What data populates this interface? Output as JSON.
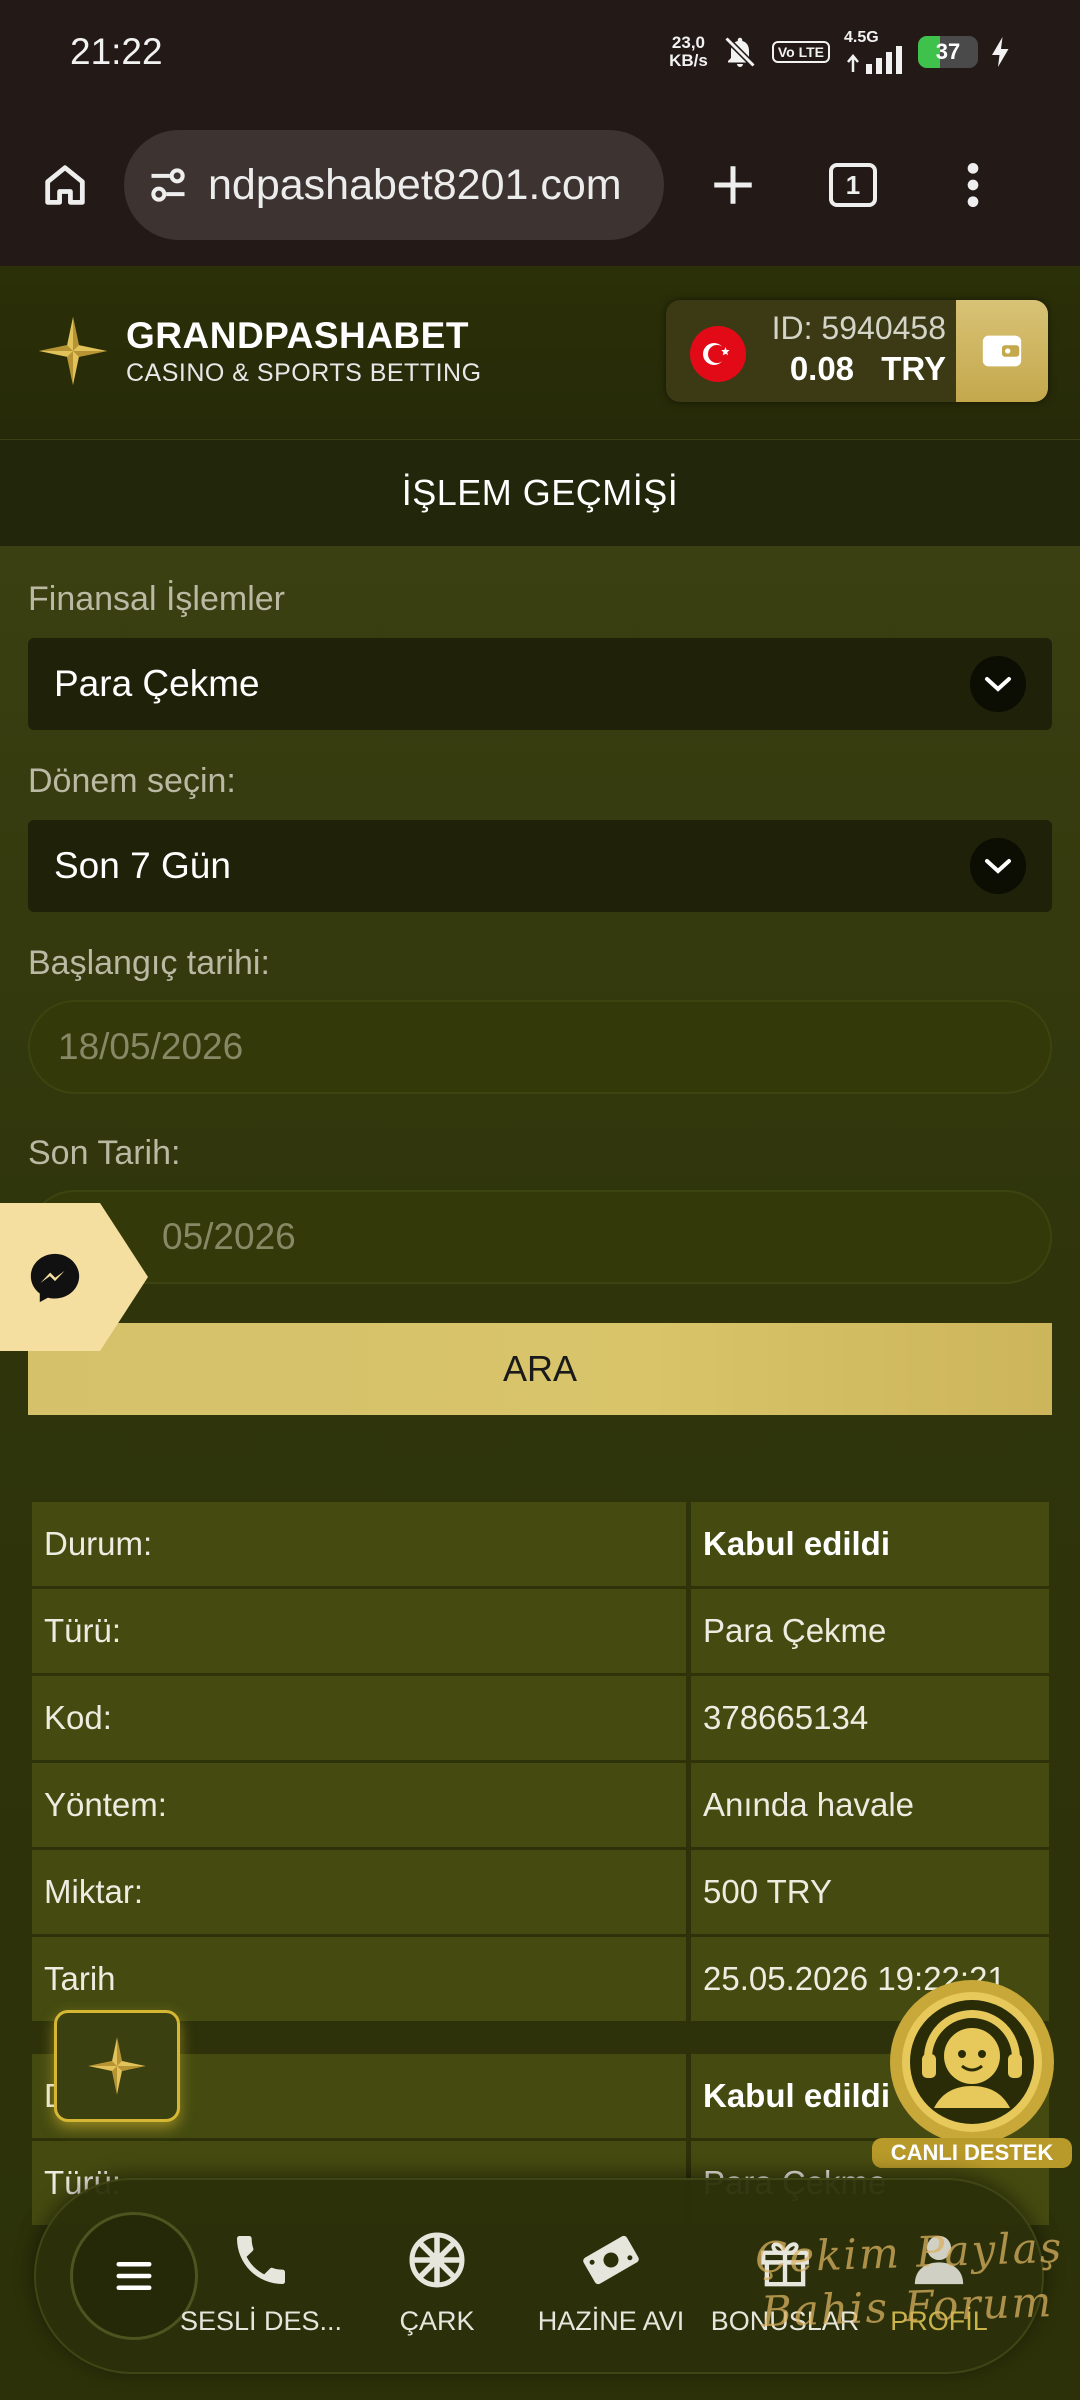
{
  "status_bar": {
    "time": "21:22",
    "net_speed": "23,0",
    "net_unit": "KB/s",
    "volte": "Vo LTE",
    "network": "4.5G",
    "battery": "37",
    "battery_level": 0.37
  },
  "browser": {
    "url": "ndpashabet8201.com",
    "tab_count": "1"
  },
  "site": {
    "brand": "GRANDPASHABET",
    "tagline": "CASINO & SPORTS BETTING",
    "account_id": "ID: 5940458",
    "balance": "0.08",
    "currency": "TRY"
  },
  "page": {
    "title": "İŞLEM GEÇMİŞİ",
    "filters": {
      "type_label": "Finansal İşlemler",
      "type_value": "Para Çekme",
      "period_label": "Dönem seçin:",
      "period_value": "Son 7 Gün",
      "start_label": "Başlangıç tarihi:",
      "start_value": "18/05/2026",
      "end_label": "Son Tarih:",
      "end_value": "05/2026",
      "search_label": "ARA"
    },
    "results": [
      {
        "rows": [
          {
            "key": "Durum:",
            "value": "Kabul edildi",
            "bold": true
          },
          {
            "key": "Türü:",
            "value": "Para Çekme"
          },
          {
            "key": "Kod:",
            "value": "378665134"
          },
          {
            "key": "Yöntem:",
            "value": "Anında havale"
          },
          {
            "key": "Miktar:",
            "value": "500 TRY"
          },
          {
            "key": "Tarih",
            "value": "25.05.2026 19:22:21"
          }
        ]
      },
      {
        "rows": [
          {
            "key": "D",
            "value": "Kabul edildi",
            "bold": true
          },
          {
            "key": "Türü:",
            "value": "Para Çekme"
          }
        ]
      }
    ]
  },
  "support": {
    "label": "CANLI DESTEK"
  },
  "bottom_nav": {
    "items": [
      {
        "label": "SESLİ DES...",
        "icon": "phone-icon"
      },
      {
        "label": "ÇARK",
        "icon": "wheel-icon"
      },
      {
        "label": "HAZİNE AVI",
        "icon": "treasure-icon"
      },
      {
        "label": "BONUSLAR",
        "icon": "gift-icon"
      },
      {
        "label": "PROFİL",
        "icon": "profile-icon"
      }
    ],
    "watermark_line1": "Çekim Paylaş",
    "watermark_line2": "Bahis Forum"
  },
  "colors": {
    "accent_gold": "#d4c16a",
    "background": "#2c3109",
    "cell": "#454b10"
  }
}
